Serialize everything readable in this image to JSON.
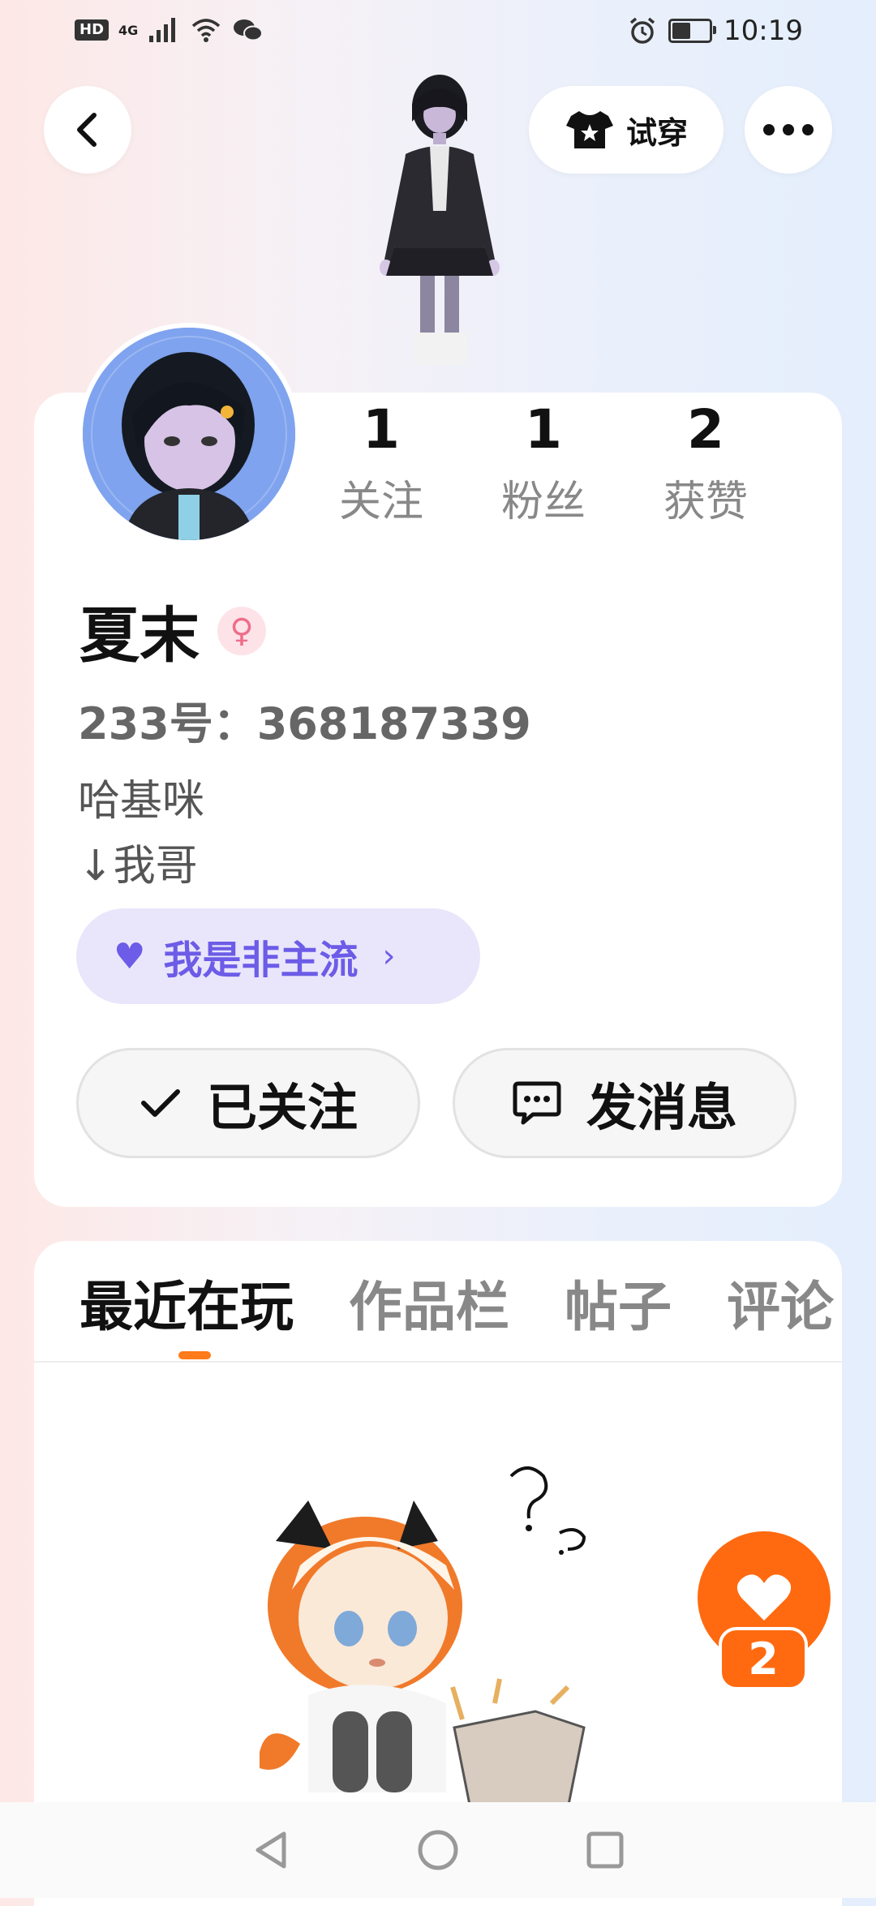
{
  "status_bar": {
    "hd": "HD",
    "network": "4G",
    "time": "10:19",
    "battery_level": 0.45
  },
  "header": {
    "try_on_label": "试穿"
  },
  "profile": {
    "stats": [
      {
        "value": "1",
        "label": "关注"
      },
      {
        "value": "1",
        "label": "粉丝"
      },
      {
        "value": "2",
        "label": "获赞"
      }
    ],
    "username": "夏末",
    "gender_icon": "female-icon",
    "uid": "233号：368187339",
    "bio_lines": [
      "哈基咪",
      "↓我哥"
    ],
    "tag": "我是非主流",
    "followed_label": "已关注",
    "message_label": "发消息"
  },
  "tabs": [
    "最近在玩",
    "作品栏",
    "帖子",
    "评论"
  ],
  "like_button": {
    "count": "2"
  },
  "colors": {
    "accent_orange": "#ff6a10",
    "tag_purple": "#6c5ce7",
    "tag_bg": "#e9e6fb"
  }
}
